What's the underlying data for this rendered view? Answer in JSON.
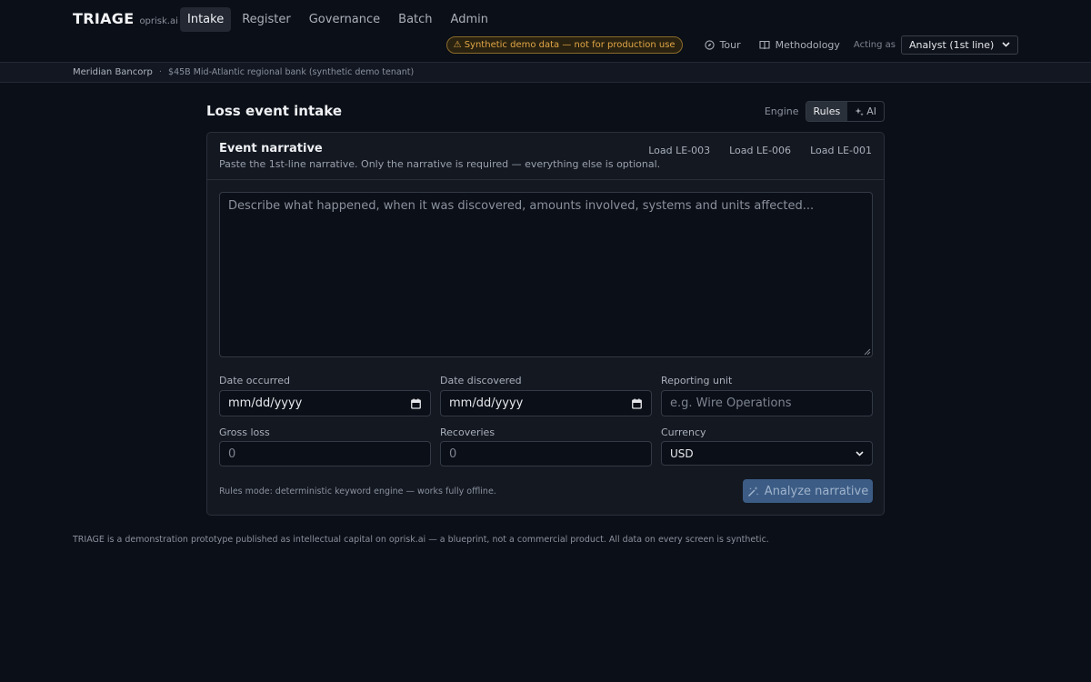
{
  "app": {
    "name": "TRIAGE",
    "domain": "oprisk.ai"
  },
  "nav": {
    "tabs": [
      {
        "label": "Intake",
        "active": true
      },
      {
        "label": "Register"
      },
      {
        "label": "Governance"
      },
      {
        "label": "Batch"
      },
      {
        "label": "Admin"
      }
    ]
  },
  "header": {
    "demo_badge": "⚠ Synthetic demo data — not for production use",
    "tour_label": "Tour",
    "methodology_label": "Methodology",
    "acting_as_label": "Acting as",
    "role_value": "Analyst (1st line)"
  },
  "tenant": {
    "name": "Meridian Bancorp",
    "separator": "·",
    "description": "$45B Mid-Atlantic regional bank (synthetic demo tenant)"
  },
  "page": {
    "title": "Loss event intake",
    "engine_label": "Engine",
    "engine_options": [
      {
        "label": "Rules",
        "active": true
      },
      {
        "label": "AI"
      }
    ]
  },
  "card": {
    "title": "Event narrative",
    "subtitle": "Paste the 1st-line narrative. Only the narrative is required — everything else is optional.",
    "loaders": [
      "Load LE-003",
      "Load LE-006",
      "Load LE-001"
    ],
    "narrative_placeholder": "Describe what happened, when it was discovered, amounts involved, systems and units affected...",
    "fields": {
      "date_occurred": {
        "label": "Date occurred",
        "value": "mm/dd/yyyy"
      },
      "date_discovered": {
        "label": "Date discovered",
        "value": "mm/dd/yyyy"
      },
      "reporting_unit": {
        "label": "Reporting unit",
        "placeholder": "e.g. Wire Operations"
      },
      "gross_loss": {
        "label": "Gross loss",
        "placeholder": "0"
      },
      "recoveries": {
        "label": "Recoveries",
        "placeholder": "0"
      },
      "currency": {
        "label": "Currency",
        "value": "USD"
      }
    },
    "mode_note": "Rules mode: deterministic keyword engine — works fully offline.",
    "analyze_label": "Analyze narrative"
  },
  "footer": {
    "note": "TRIAGE is a demonstration prototype published as intellectual capital on oprisk.ai — a blueprint, not a commercial product. All data on every screen is synthetic."
  },
  "colors": {
    "background": "#0b0f17",
    "card": "#131821",
    "accent_button": "#3c5c85",
    "warning": "#e0a646"
  },
  "icons": {
    "tour": "compass-icon",
    "methodology": "book-icon",
    "ai": "sparkle-icon",
    "analyze": "wand-icon",
    "calendar": "calendar-icon"
  }
}
